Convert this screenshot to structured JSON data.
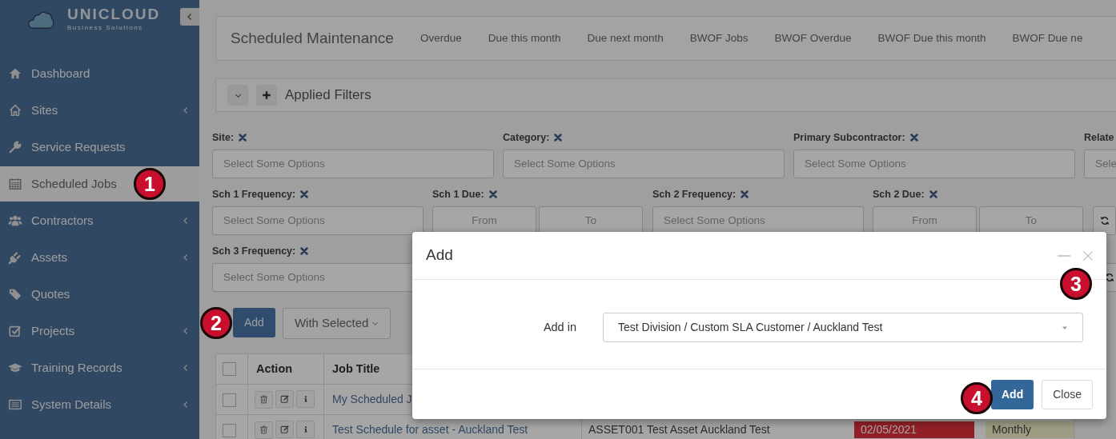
{
  "brand": {
    "name": "UNICLOUD",
    "tagline": "Business Solutions"
  },
  "sidebar": {
    "items": [
      {
        "label": "Dashboard",
        "has_submenu": false,
        "selected": false
      },
      {
        "label": "Sites",
        "has_submenu": true,
        "selected": false
      },
      {
        "label": "Service Requests",
        "has_submenu": false,
        "selected": false
      },
      {
        "label": "Scheduled Jobs",
        "has_submenu": false,
        "selected": true
      },
      {
        "label": "Contractors",
        "has_submenu": true,
        "selected": false
      },
      {
        "label": "Assets",
        "has_submenu": true,
        "selected": false
      },
      {
        "label": "Quotes",
        "has_submenu": false,
        "selected": false
      },
      {
        "label": "Projects",
        "has_submenu": true,
        "selected": false
      },
      {
        "label": "Training Records",
        "has_submenu": true,
        "selected": false
      },
      {
        "label": "System Details",
        "has_submenu": true,
        "selected": false
      }
    ]
  },
  "tabs": {
    "title": "Scheduled Maintenance",
    "items": [
      "Overdue",
      "Due this month",
      "Due next month",
      "BWOF Jobs",
      "BWOF Overdue",
      "BWOF Due this month",
      "BWOF Due ne"
    ]
  },
  "filters_panel": {
    "title": "Applied Filters"
  },
  "filter_rows": [
    {
      "refresh": false,
      "filters": [
        {
          "kind": "select",
          "label": "Site:",
          "placeholder": "Select Some Options"
        },
        {
          "kind": "select",
          "label": "Category:",
          "placeholder": "Select Some Options"
        },
        {
          "kind": "select",
          "label": "Primary Subcontractor:",
          "placeholder": "Select Some Options"
        },
        {
          "kind": "cut",
          "label": "Relate",
          "placeholder": "Sele"
        }
      ]
    },
    {
      "refresh": true,
      "filters": [
        {
          "kind": "select",
          "label": "Sch 1 Frequency:",
          "placeholder": "Select Some Options"
        },
        {
          "kind": "range",
          "label": "Sch 1 Due:",
          "from": "From",
          "to": "To"
        },
        {
          "kind": "select",
          "label": "Sch 2 Frequency:",
          "placeholder": "Select Some Options"
        },
        {
          "kind": "range",
          "label": "Sch 2 Due:",
          "from": "From",
          "to": "To"
        }
      ]
    },
    {
      "refresh": true,
      "filters": [
        {
          "kind": "select",
          "label": "Sch 3 Frequency:",
          "placeholder": "Select Some Options"
        }
      ]
    }
  ],
  "toolbar": {
    "add": "Add",
    "with_selected": "With Selected"
  },
  "table": {
    "select_all_checked": false,
    "columns": [
      "Action",
      "Job Title"
    ],
    "rows": [
      {
        "checked": false,
        "job_title": "My Scheduled J"
      },
      {
        "checked": false,
        "job_title": "Test Schedule for asset - Auckland Test",
        "asset": "ASSET001 Test Asset Auckland Test",
        "due": "02/05/2021",
        "overdue": true,
        "frequency": "Monthly"
      }
    ]
  },
  "modal": {
    "title": "Add",
    "field_label": "Add in",
    "field_value": "Test Division / Custom SLA Customer / Auckland Test",
    "buttons": [
      {
        "label": "Add",
        "kind": "primary"
      },
      {
        "label": "Close",
        "kind": "secondary"
      }
    ]
  },
  "callouts": [
    {
      "number": "1"
    },
    {
      "number": "2"
    },
    {
      "number": "3"
    },
    {
      "number": "4"
    }
  ]
}
